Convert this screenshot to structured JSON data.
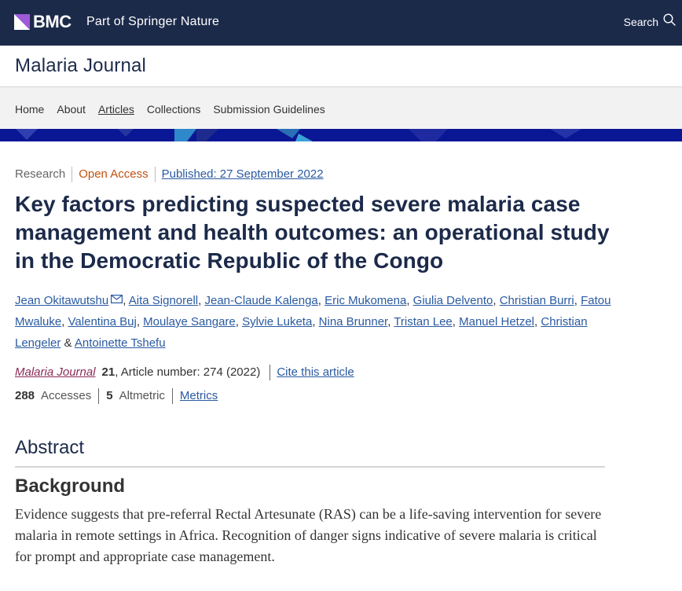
{
  "header": {
    "brand": "BMC",
    "tagline": "Part of Springer Nature",
    "search_label": "Search",
    "icons": {
      "logo": "bmc-logo-mark",
      "search": "search-icon"
    },
    "colors": {
      "bar": "#1c2a4a",
      "logo_accent": "#9e5ad8"
    }
  },
  "journal": {
    "title": "Malaria Journal"
  },
  "nav": {
    "items": [
      {
        "label": "Home"
      },
      {
        "label": "About"
      },
      {
        "label": "Articles"
      },
      {
        "label": "Collections"
      },
      {
        "label": "Submission Guidelines"
      }
    ],
    "active": "Articles"
  },
  "article": {
    "type": "Research",
    "access": "Open Access",
    "published": "Published: 27 September 2022",
    "title": "Key factors predicting suspected severe malaria case management and health outcomes: an operational study in the Democratic Republic of the Congo",
    "authors": [
      "Jean Okitawutshu",
      "Aita Signorell",
      "Jean-Claude Kalenga",
      "Eric Mukomena",
      "Giulia Delvento",
      "Christian Burri",
      "Fatou Mwaluke",
      "Valentina Buj",
      "Moulaye Sangare",
      "Sylvie Luketa",
      "Nina Brunner",
      "Tristan Lee",
      "Manuel Hetzel",
      "Christian Lengeler",
      "Antoinette Tshefu"
    ],
    "author_separator": ", ",
    "author_final_separator": " & ",
    "citation": {
      "journal": "Malaria Journal",
      "volume": "21",
      "article_number": ", Article number: 274 (2022)",
      "cite_label": "Cite this article"
    },
    "metrics": {
      "accesses_count": "288",
      "accesses_label": "Accesses",
      "altmetric_count": "5",
      "altmetric_label": "Altmetric",
      "metrics_link": "Metrics"
    }
  },
  "abstract": {
    "heading": "Abstract",
    "section_heading": "Background",
    "text": "Evidence suggests that pre-referral Rectal Artesunate (RAS) can be a life-saving intervention for severe malaria in remote settings in Africa. Recognition of danger signs indicative of severe malaria is critical for prompt and appropriate case management."
  }
}
